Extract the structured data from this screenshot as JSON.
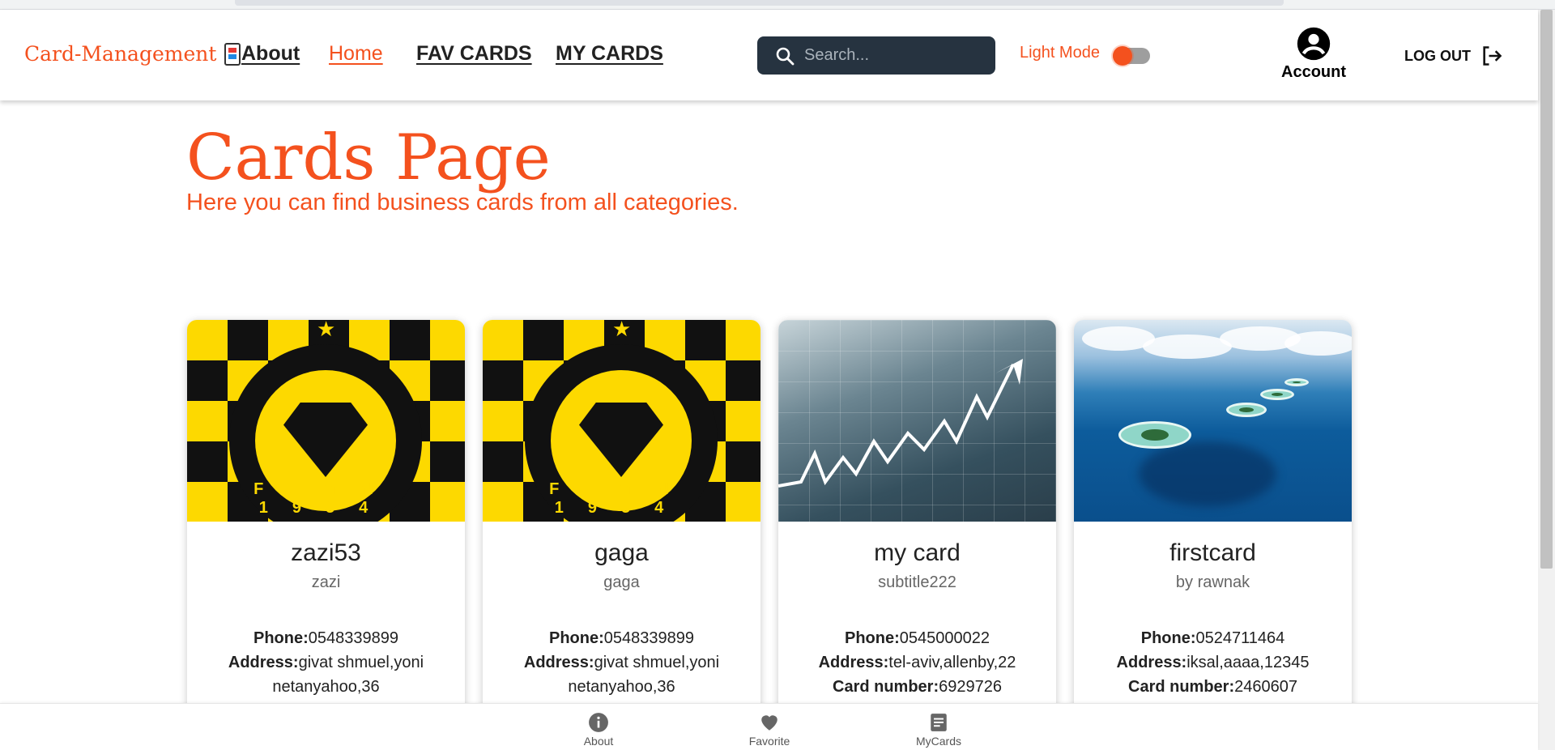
{
  "navbar": {
    "brand": "Card-Management",
    "links": [
      "About",
      "Home",
      "FAV CARDS",
      "MY CARDS"
    ],
    "active_link": "Home",
    "search_placeholder": "Search...",
    "light_mode_label": "Light Mode",
    "account_label": "Account",
    "logout_label": "LOG OUT"
  },
  "page": {
    "title": "Cards Page",
    "subtitle": "Here you can find business cards from all categories."
  },
  "cards": [
    {
      "title": "zazi53",
      "subtitle": "zazi",
      "phone_label": "Phone:",
      "phone": "0548339899",
      "address_label": "Address:",
      "address": "givat shmuel,yoni netanyahoo,36",
      "image": "maccabi-netanya-logo",
      "image_text": "FCMN 1934"
    },
    {
      "title": "gaga",
      "subtitle": "gaga",
      "phone_label": "Phone:",
      "phone": "0548339899",
      "address_label": "Address:",
      "address": "givat shmuel,yoni netanyahoo,36",
      "image": "maccabi-netanya-logo",
      "image_text": "FCMN 1934"
    },
    {
      "title": "my card",
      "subtitle": "subtitle222",
      "phone_label": "Phone:",
      "phone": "0545000022",
      "address_label": "Address:",
      "address": "tel-aviv,allenby,22",
      "card_number_label": "Card number:",
      "card_number": "6929726",
      "image": "business-chart-photo"
    },
    {
      "title": "firstcard",
      "subtitle": "by rawnak",
      "phone_label": "Phone:",
      "phone": "0524711464",
      "address_label": "Address:",
      "address": "iksal,aaaa,12345",
      "card_number_label": "Card number:",
      "card_number": "2460607",
      "image": "tropical-islands-photo"
    }
  ],
  "bottom_nav": [
    "About",
    "Favorite",
    "MyCards"
  ],
  "colors": {
    "accent": "#f4511e",
    "search_bg": "#263340",
    "maccabi_yellow": "#fdd900"
  }
}
